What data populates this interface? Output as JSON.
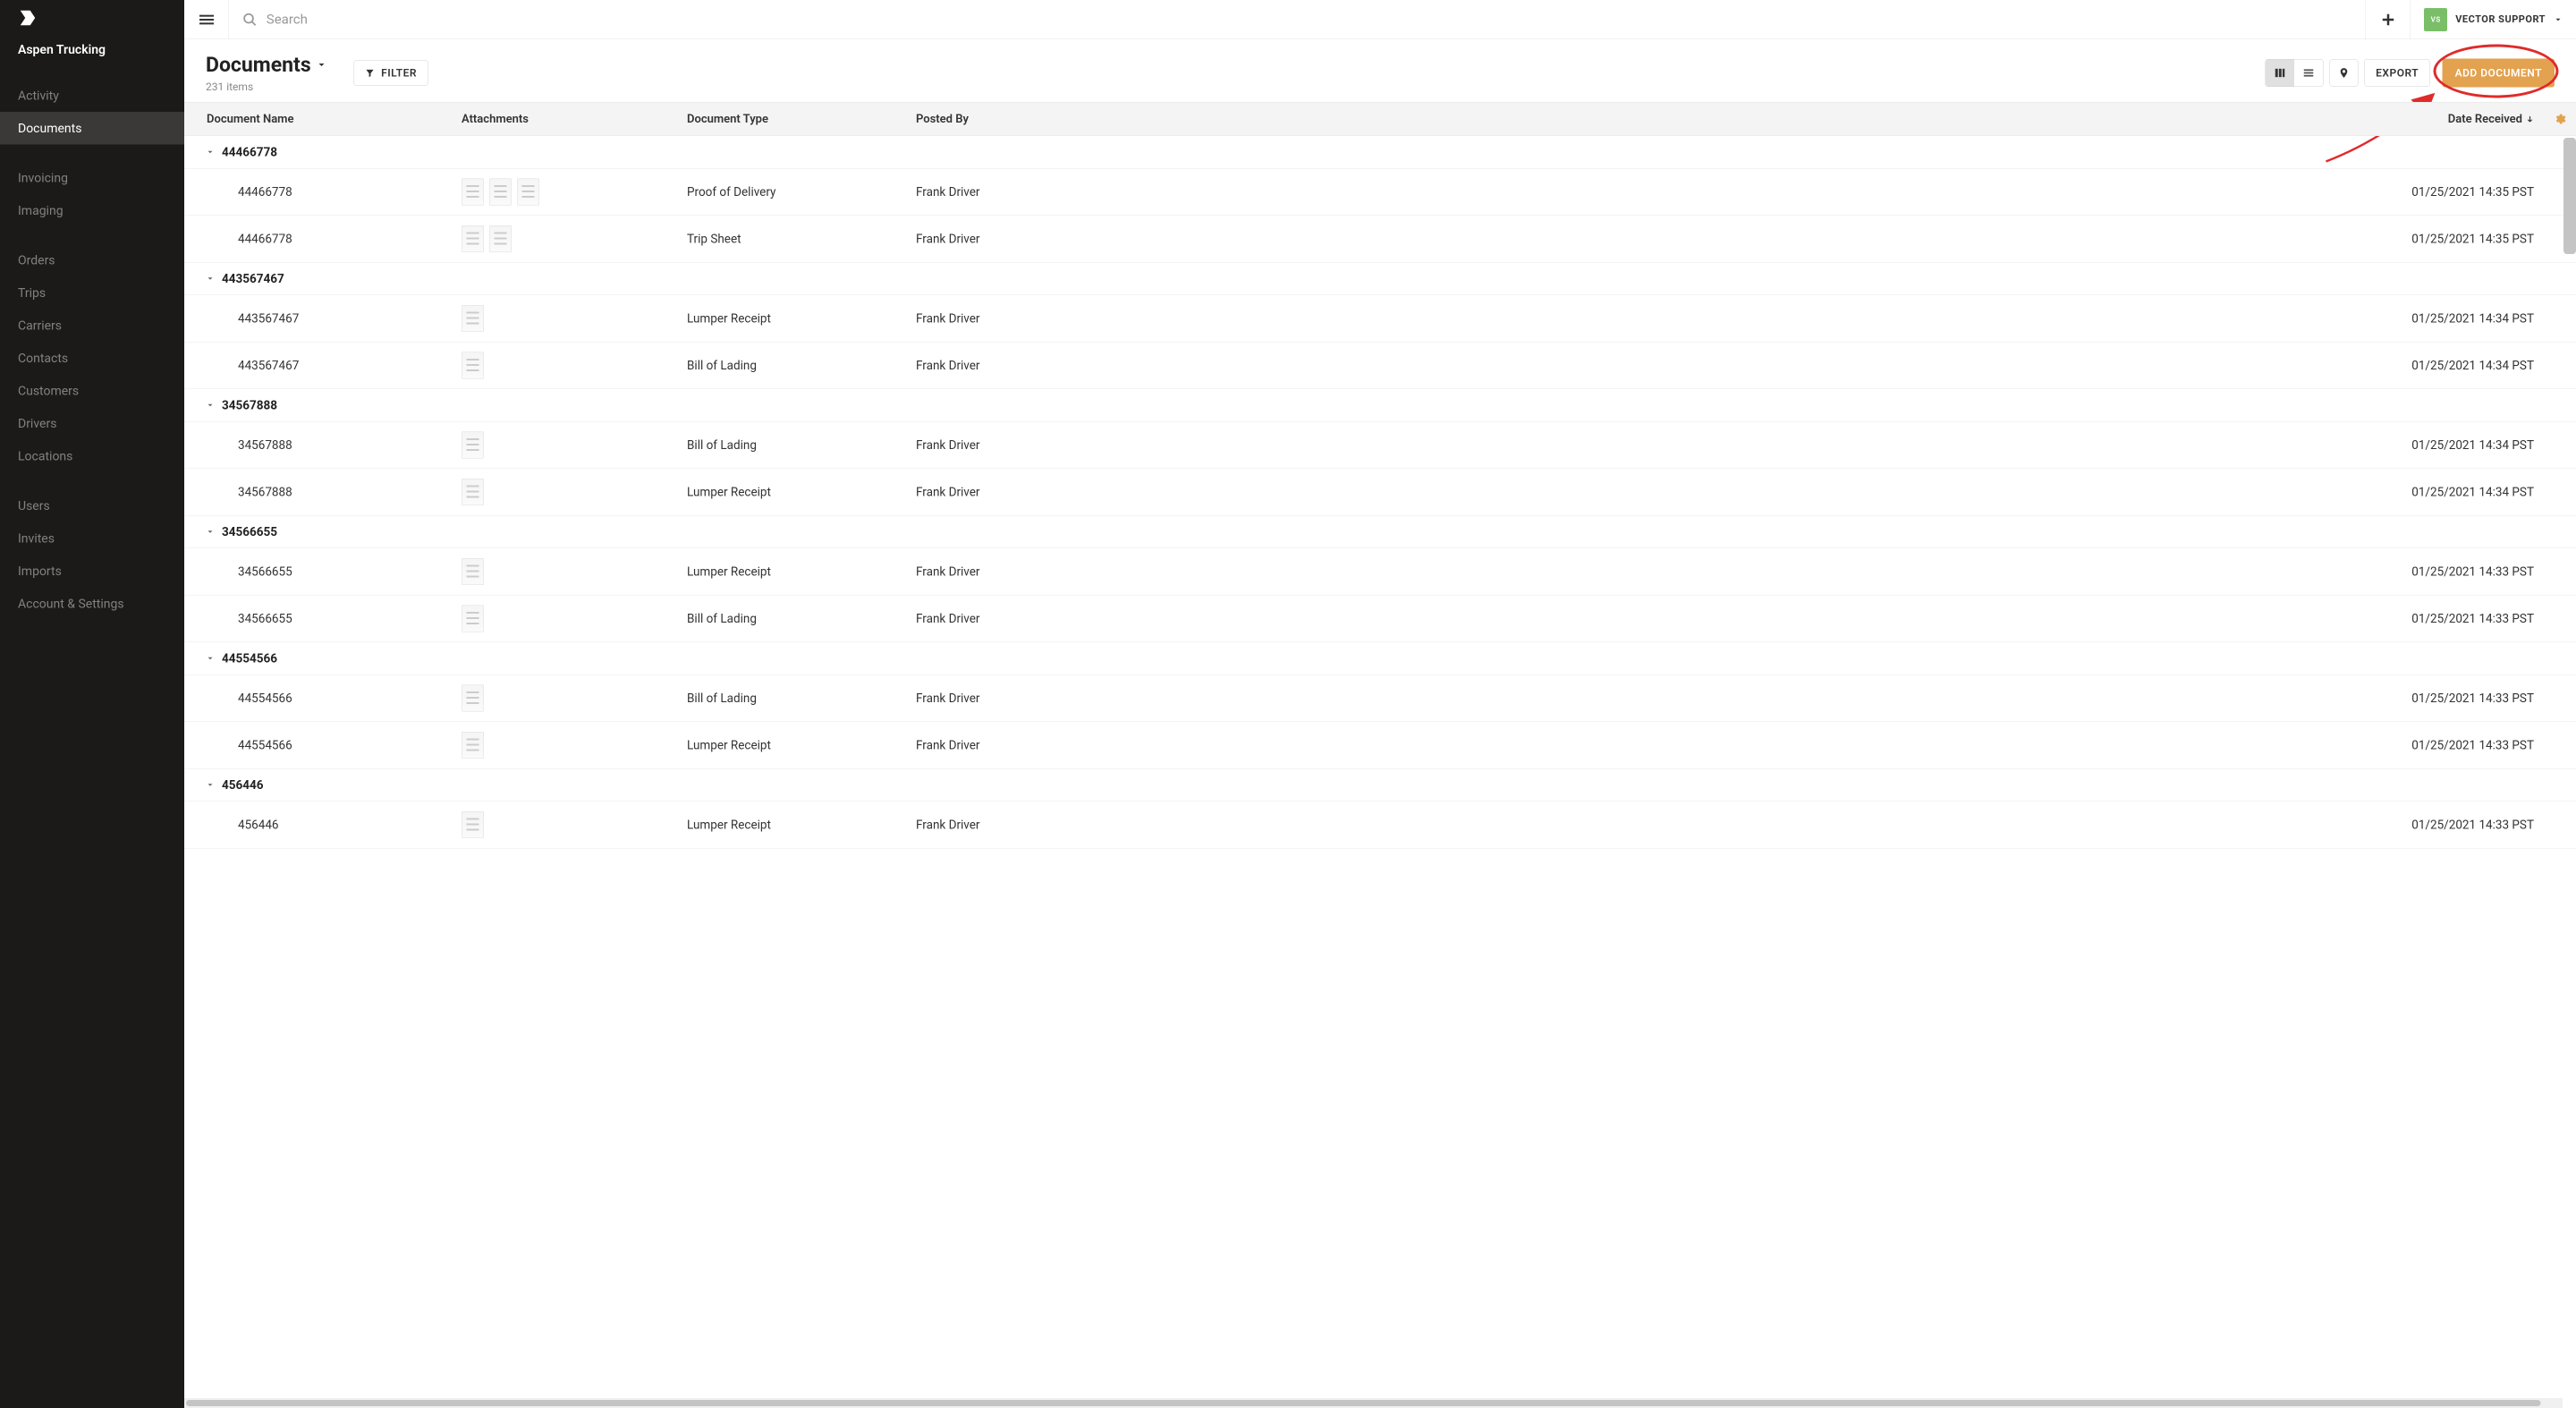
{
  "sidebar": {
    "company": "Aspen Trucking",
    "items": [
      {
        "label": "Activity"
      },
      {
        "label": "Documents",
        "active": true
      },
      {
        "gap": true
      },
      {
        "label": "Invoicing"
      },
      {
        "label": "Imaging"
      },
      {
        "gap": true
      },
      {
        "label": "Orders"
      },
      {
        "label": "Trips"
      },
      {
        "label": "Carriers"
      },
      {
        "label": "Contacts"
      },
      {
        "label": "Customers"
      },
      {
        "label": "Drivers"
      },
      {
        "label": "Locations"
      },
      {
        "gap": true
      },
      {
        "label": "Users"
      },
      {
        "label": "Invites"
      },
      {
        "label": "Imports"
      },
      {
        "label": "Account & Settings"
      }
    ]
  },
  "topbar": {
    "search_placeholder": "Search",
    "user_initials": "VS",
    "user_name": "VECTOR SUPPORT"
  },
  "page": {
    "title": "Documents",
    "sub": "231 items",
    "filter_label": "FILTER",
    "export_label": "EXPORT",
    "add_label": "ADD DOCUMENT"
  },
  "columns": {
    "name": "Document Name",
    "attachments": "Attachments",
    "type": "Document Type",
    "posted": "Posted By",
    "date": "Date Received"
  },
  "groups": [
    {
      "id": "44466778",
      "rows": [
        {
          "name": "44466778",
          "thumbs": 3,
          "type": "Proof of Delivery",
          "posted": "Frank Driver",
          "date": "01/25/2021 14:35 PST"
        },
        {
          "name": "44466778",
          "thumbs": 2,
          "type": "Trip Sheet",
          "posted": "Frank Driver",
          "date": "01/25/2021 14:35 PST"
        }
      ]
    },
    {
      "id": "443567467",
      "rows": [
        {
          "name": "443567467",
          "thumbs": 1,
          "type": "Lumper Receipt",
          "posted": "Frank Driver",
          "date": "01/25/2021 14:34 PST"
        },
        {
          "name": "443567467",
          "thumbs": 1,
          "type": "Bill of Lading",
          "posted": "Frank Driver",
          "date": "01/25/2021 14:34 PST"
        }
      ]
    },
    {
      "id": "34567888",
      "rows": [
        {
          "name": "34567888",
          "thumbs": 1,
          "type": "Bill of Lading",
          "posted": "Frank Driver",
          "date": "01/25/2021 14:34 PST"
        },
        {
          "name": "34567888",
          "thumbs": 1,
          "type": "Lumper Receipt",
          "posted": "Frank Driver",
          "date": "01/25/2021 14:34 PST"
        }
      ]
    },
    {
      "id": "34566655",
      "rows": [
        {
          "name": "34566655",
          "thumbs": 1,
          "type": "Lumper Receipt",
          "posted": "Frank Driver",
          "date": "01/25/2021 14:33 PST"
        },
        {
          "name": "34566655",
          "thumbs": 1,
          "type": "Bill of Lading",
          "posted": "Frank Driver",
          "date": "01/25/2021 14:33 PST"
        }
      ]
    },
    {
      "id": "44554566",
      "rows": [
        {
          "name": "44554566",
          "thumbs": 1,
          "type": "Bill of Lading",
          "posted": "Frank Driver",
          "date": "01/25/2021 14:33 PST"
        },
        {
          "name": "44554566",
          "thumbs": 1,
          "type": "Lumper Receipt",
          "posted": "Frank Driver",
          "date": "01/25/2021 14:33 PST"
        }
      ]
    },
    {
      "id": "456446",
      "rows": [
        {
          "name": "456446",
          "thumbs": 1,
          "type": "Lumper Receipt",
          "posted": "Frank Driver",
          "date": "01/25/2021 14:33 PST"
        }
      ]
    }
  ]
}
